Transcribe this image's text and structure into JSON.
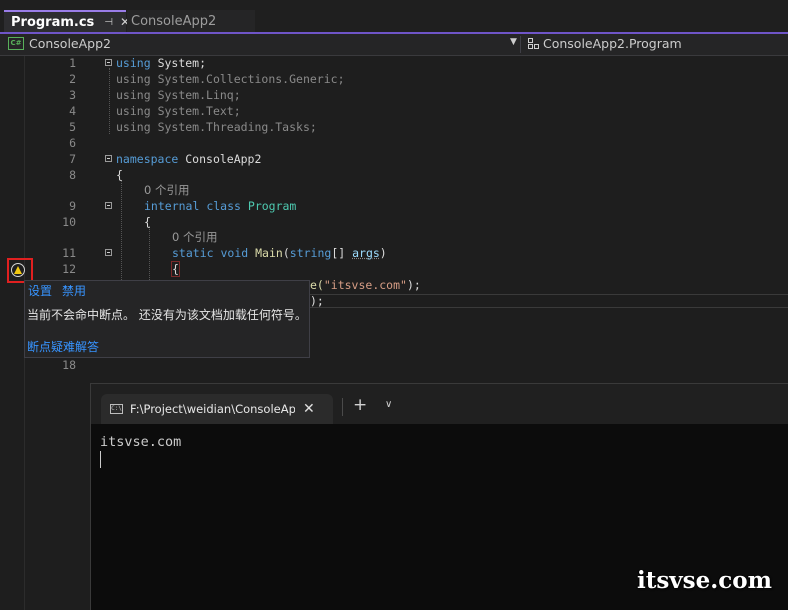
{
  "tabs": [
    {
      "label": "Program.cs",
      "active": true,
      "pin_icon": "pin-icon",
      "close_icon": "close-icon"
    },
    {
      "label": "ConsoleApp2",
      "active": false
    }
  ],
  "navbar": {
    "project": "ConsoleApp2",
    "member": "ConsoleApp2.Program"
  },
  "code": {
    "line_numbers": [
      "1",
      "2",
      "3",
      "4",
      "5",
      "6",
      "7",
      "8",
      "9",
      "10",
      "11",
      "12",
      "18"
    ],
    "using_kw": "using",
    "usings": [
      "System;",
      "System.Collections.Generic;",
      "System.Linq;",
      "System.Text;",
      "System.Threading.Tasks;"
    ],
    "namespace_kw": "namespace",
    "namespace_name": "ConsoleApp2",
    "open_brace": "{",
    "ref_count": "0 个引用",
    "internal_kw": "internal",
    "class_kw": "class",
    "class_name": "Program",
    "static_kw": "static",
    "void_kw": "void",
    "method_name": "Main",
    "param_type": "string",
    "param_brackets": "[] ",
    "param_name": "args",
    "close_paren": ")",
    "partial_call": "e(",
    "string_literal": "\"itsvse.com\"",
    "line_end": ");",
    "partial_line_14": ");"
  },
  "tooltip": {
    "settings_link": "设置",
    "disable_link": "禁用",
    "message": "当前不会命中断点。 还没有为该文档加载任何符号。",
    "help_link": "断点疑难解答"
  },
  "terminal": {
    "tab_title": "F:\\Project\\weidian\\ConsoleAp",
    "tab_icon_text": "C:\\",
    "output": "itsvse.com"
  },
  "watermark": "itsvse.com",
  "colors": {
    "accent": "#6f55c8",
    "keyword": "#569cd6",
    "type": "#4ec9b0",
    "string": "#d69d85",
    "link": "#3794ff",
    "warning": "#f2c811",
    "highlight_box": "#e02020"
  }
}
